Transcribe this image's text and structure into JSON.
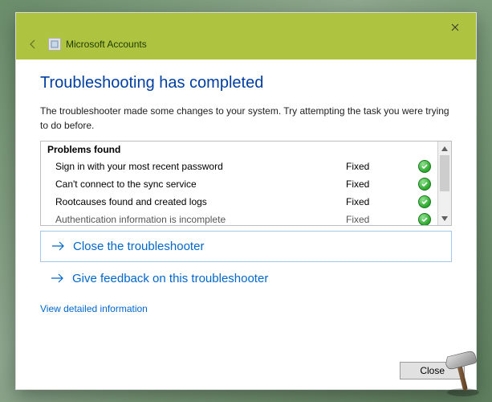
{
  "header": {
    "title": "Microsoft Accounts"
  },
  "main": {
    "heading": "Troubleshooting has completed",
    "description": "The troubleshooter made some changes to your system. Try attempting the task you were trying to do before.",
    "problems_header": "Problems found",
    "problems": [
      {
        "name": "Sign in with your most recent password",
        "status": "Fixed"
      },
      {
        "name": "Can't connect to the sync service",
        "status": "Fixed"
      },
      {
        "name": "Rootcauses found and created logs",
        "status": "Fixed"
      },
      {
        "name": "Authentication information is incomplete",
        "status": "Fixed"
      }
    ],
    "actions": {
      "close_troubleshooter": "Close the troubleshooter",
      "give_feedback": "Give feedback on this troubleshooter"
    },
    "detail_link": "View detailed information"
  },
  "footer": {
    "close_label": "Close"
  }
}
